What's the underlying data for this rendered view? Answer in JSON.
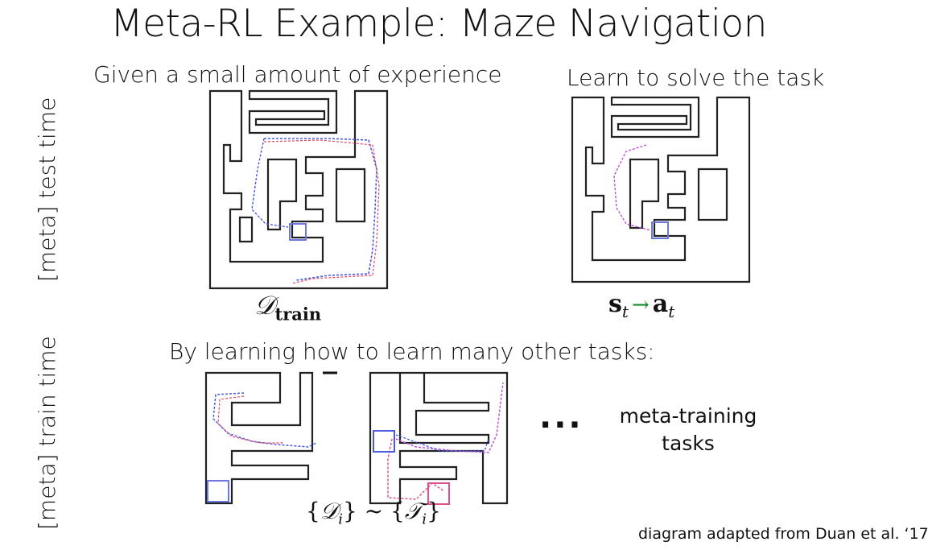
{
  "title": "Meta-RL Example: Maze Navigation",
  "captions": {
    "left": "Given a small amount of experience",
    "right": "Learn to solve the task",
    "bottom": "By learning how to learn many other tasks:"
  },
  "side_labels": {
    "test": "[meta] test time",
    "train": "[meta] train time"
  },
  "math": {
    "d_main": "𝒟",
    "d_sub": "train",
    "s": "s",
    "s_sub": "t",
    "arrow": "→",
    "a": "a",
    "a_sub": "t",
    "tasks_left_open": "{",
    "tasks_d": "𝒟",
    "tasks_d_sub": "i",
    "tasks_sim": "} ~ {",
    "tasks_t": "𝒯",
    "tasks_t_sub": "i",
    "tasks_close": "}"
  },
  "ellipsis": "···",
  "meta_training_label_1": "meta-training",
  "meta_training_label_2": "tasks",
  "credit": "diagram adapted from Duan et al. ‘17",
  "colors": {
    "wall": "#222222",
    "trajectory_blue": "#4a5be0",
    "trajectory_red": "#e04a6a",
    "trajectory_magenta": "#c050d8",
    "goal_blue": "#6a78e0",
    "goal_pink": "#e0508a",
    "arrow_green": "#1a8a2a"
  }
}
